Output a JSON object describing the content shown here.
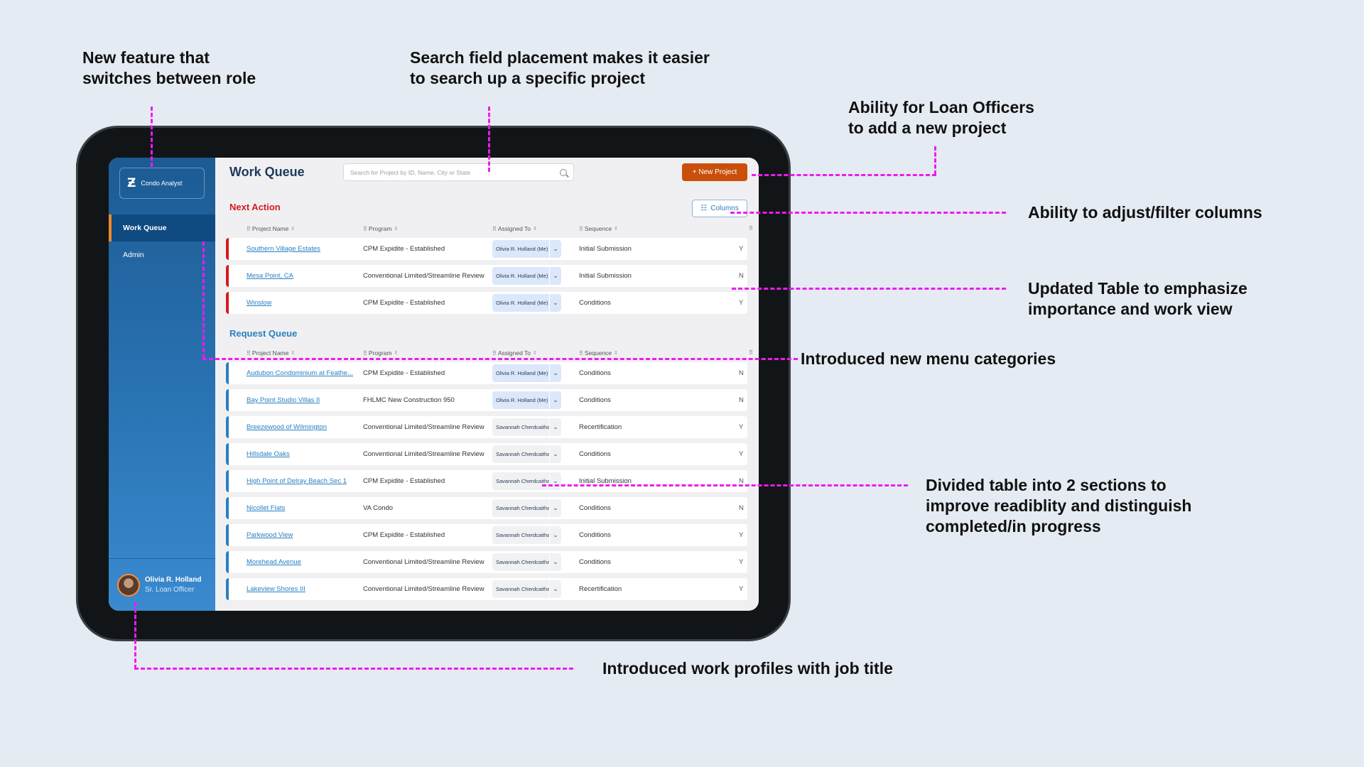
{
  "annotations": {
    "role_switch": "New feature that\nswitches between role",
    "search": "Search field placement makes it easier\nto search up a specific project",
    "new_project": "Ability for Loan Officers\nto add a new project",
    "columns": "Ability to adjust/filter columns",
    "updated_table": "Updated Table to emphasize\nimportance and work view",
    "menu_categories": "Introduced new menu categories",
    "divided_table": "Divided table into 2 sections to\nimprove readiblity and distinguish\ncompleted/in progress",
    "profiles": "Introduced work profiles with job title"
  },
  "colors": {
    "annotation_line": "#f01af0",
    "primary_blue": "#2a7fc0",
    "next_action_red": "#d41b1b",
    "new_project_orange": "#c94f0a",
    "active_nav_accent": "#f08a2a"
  },
  "app": {
    "logo_icon": "z-logo-icon",
    "role_label": "Condo Analyst",
    "nav": [
      {
        "label": "Work Queue",
        "active": true
      },
      {
        "label": "Admin",
        "active": false
      }
    ],
    "profile": {
      "name": "Olivia R. Holland",
      "title": "Sr. Loan Officer"
    }
  },
  "header": {
    "title": "Work Queue",
    "search_placeholder": "Search for Project by ID, Name, City or State",
    "new_project_label": "+ New Project"
  },
  "columns_button": "Columns",
  "table_headers": [
    "Project Name",
    "Program",
    "Assigned To",
    "Sequence",
    ""
  ],
  "next_action": {
    "title": "Next Action",
    "rows": [
      {
        "name": "Southern Village Estates",
        "program": "CPM Expidite - Established",
        "assigned": "Olivia R. Holland (Me)",
        "me": true,
        "sequence": "Initial Submission",
        "last": "Y"
      },
      {
        "name": "Mesa Point, CA",
        "program": "Conventional Limited/Streamline Review",
        "assigned": "Olivia R. Holland (Me)",
        "me": true,
        "sequence": "Initial Submission",
        "last": "N"
      },
      {
        "name": "Winslow",
        "program": "CPM Expidite - Established",
        "assigned": "Olivia R. Holland (Me)",
        "me": true,
        "sequence": "Conditions",
        "last": "Y"
      }
    ]
  },
  "request_queue": {
    "title": "Request Queue",
    "rows": [
      {
        "name": "Audubon Condominium at Feathe...",
        "program": "CPM Expidite - Established",
        "assigned": "Olivia R. Holland (Me)",
        "me": true,
        "sequence": "Conditions",
        "last": "N"
      },
      {
        "name": "Bay Point Studio Villas II",
        "program": "FHLMC New Construction 950",
        "assigned": "Olivia R. Holland (Me)",
        "me": true,
        "sequence": "Conditions",
        "last": "N"
      },
      {
        "name": "Breezewood of Wilmington",
        "program": "Conventional Limited/Streamline Review",
        "assigned": "Savannah Cherdcaitha...",
        "me": false,
        "sequence": "Recertification",
        "last": "Y"
      },
      {
        "name": "Hillsdale Oaks",
        "program": "Conventional Limited/Streamline Review",
        "assigned": "Savannah Cherdcaitha...",
        "me": false,
        "sequence": "Conditions",
        "last": "Y"
      },
      {
        "name": "High Point of Delray Beach Sec 1",
        "program": "CPM Expidite - Established",
        "assigned": "Savannah Cherdcaitha...",
        "me": false,
        "sequence": "Initial Submission",
        "last": "N"
      },
      {
        "name": "Nicollet Flats",
        "program": "VA Condo",
        "assigned": "Savannah Cherdcaitha...",
        "me": false,
        "sequence": "Conditions",
        "last": "N"
      },
      {
        "name": "Parkwood View",
        "program": "CPM Expidite - Established",
        "assigned": "Savannah Cherdcaitha...",
        "me": false,
        "sequence": "Conditions",
        "last": "Y"
      },
      {
        "name": "Morehead Avenue",
        "program": "Conventional Limited/Streamline Review",
        "assigned": "Savannah Cherdcaitha...",
        "me": false,
        "sequence": "Conditions",
        "last": "Y"
      },
      {
        "name": "Lakeview Shores III",
        "program": "Conventional Limited/Streamline Review",
        "assigned": "Savannah Cherdcaitha...",
        "me": false,
        "sequence": "Recertification",
        "last": "Y"
      }
    ]
  }
}
